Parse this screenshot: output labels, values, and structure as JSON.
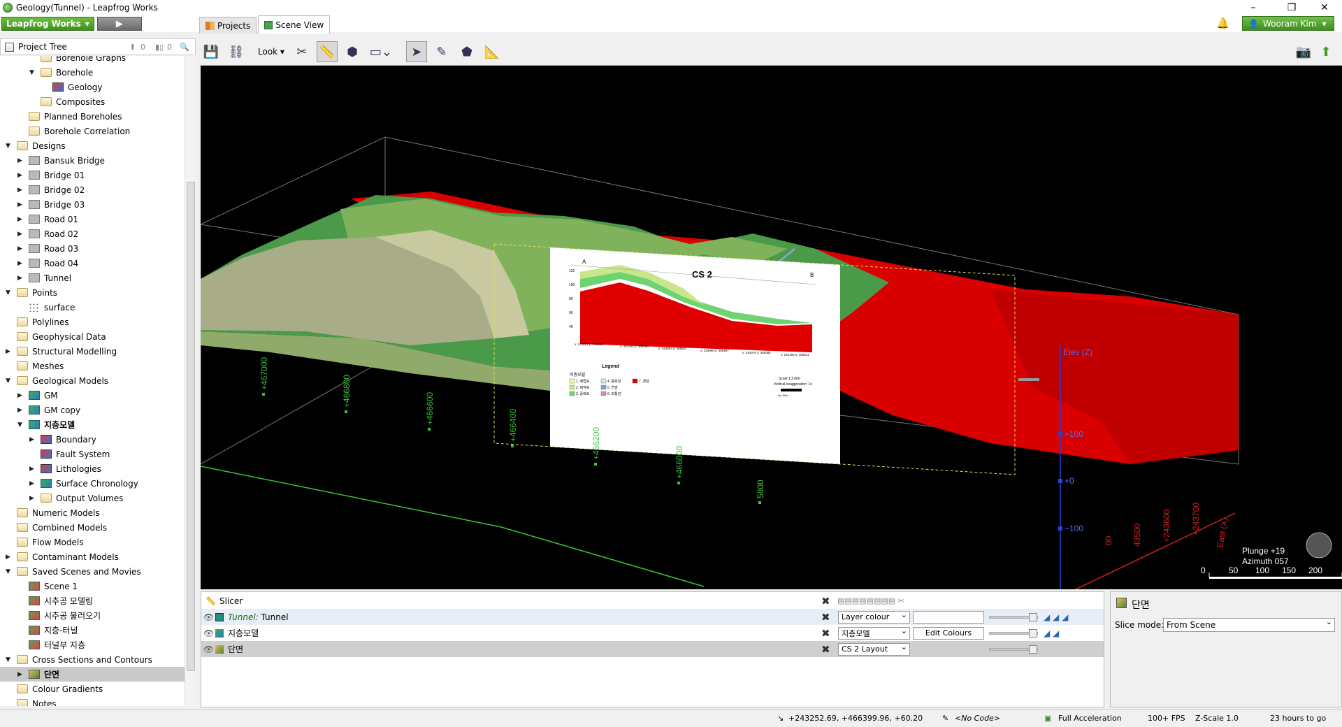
{
  "window": {
    "title": "Geology(Tunnel) - Leapfrog Works",
    "minimize": "–",
    "maximize": "❐",
    "close": "✕"
  },
  "toolbar": {
    "app_button": "Leapfrog Works",
    "app_caret": "▾",
    "play": "▶",
    "bell": "🔔",
    "user": "Wooram Kim",
    "user_caret": "▾"
  },
  "tabs": [
    {
      "label": "Projects"
    },
    {
      "label": "Scene View"
    }
  ],
  "project_tree": {
    "header": "Project Tree",
    "count_a": "0",
    "count_b": "0",
    "items": [
      {
        "label": "Borehole Graphs",
        "depth": 2,
        "icon": "folder",
        "expander": ""
      },
      {
        "label": "Borehole",
        "depth": 2,
        "icon": "folder",
        "expander": "▼"
      },
      {
        "label": "Geology",
        "depth": 3,
        "icon": "geo",
        "expander": ""
      },
      {
        "label": "Composites",
        "depth": 2,
        "icon": "folder",
        "expander": ""
      },
      {
        "label": "Planned Boreholes",
        "depth": 1,
        "icon": "folder",
        "expander": ""
      },
      {
        "label": "Borehole Correlation",
        "depth": 1,
        "icon": "folder",
        "expander": ""
      },
      {
        "label": "Designs",
        "depth": 0,
        "icon": "folder",
        "expander": "▼"
      },
      {
        "label": "Bansuk Bridge",
        "depth": 1,
        "icon": "bore",
        "expander": "▶"
      },
      {
        "label": "Bridge 01",
        "depth": 1,
        "icon": "bore",
        "expander": "▶"
      },
      {
        "label": "Bridge 02",
        "depth": 1,
        "icon": "bore",
        "expander": "▶"
      },
      {
        "label": "Bridge 03",
        "depth": 1,
        "icon": "bore",
        "expander": "▶"
      },
      {
        "label": "Road 01",
        "depth": 1,
        "icon": "bore",
        "expander": "▶"
      },
      {
        "label": "Road 02",
        "depth": 1,
        "icon": "bore",
        "expander": "▶"
      },
      {
        "label": "Road 03",
        "depth": 1,
        "icon": "bore",
        "expander": "▶"
      },
      {
        "label": "Road 04",
        "depth": 1,
        "icon": "bore",
        "expander": "▶"
      },
      {
        "label": "Tunnel",
        "depth": 1,
        "icon": "bore",
        "expander": "▶"
      },
      {
        "label": "Points",
        "depth": 0,
        "icon": "folder",
        "expander": "▼"
      },
      {
        "label": "surface",
        "depth": 1,
        "icon": "pts",
        "expander": ""
      },
      {
        "label": "Polylines",
        "depth": 0,
        "icon": "folder",
        "expander": ""
      },
      {
        "label": "Geophysical Data",
        "depth": 0,
        "icon": "folder",
        "expander": ""
      },
      {
        "label": "Structural Modelling",
        "depth": 0,
        "icon": "folder",
        "expander": "▶"
      },
      {
        "label": "Meshes",
        "depth": 0,
        "icon": "folder",
        "expander": ""
      },
      {
        "label": "Geological Models",
        "depth": 0,
        "icon": "folder",
        "expander": "▼"
      },
      {
        "label": "GM",
        "depth": 1,
        "icon": "gm",
        "expander": "▶"
      },
      {
        "label": "GM copy",
        "depth": 1,
        "icon": "gm",
        "expander": "▶"
      },
      {
        "label": "지층모델",
        "depth": 1,
        "icon": "gm",
        "expander": "▼",
        "bold": true
      },
      {
        "label": "Boundary",
        "depth": 2,
        "icon": "geo",
        "expander": "▶"
      },
      {
        "label": "Fault System",
        "depth": 2,
        "icon": "geo",
        "expander": ""
      },
      {
        "label": "Lithologies",
        "depth": 2,
        "icon": "geo",
        "expander": "▶"
      },
      {
        "label": "Surface Chronology",
        "depth": 2,
        "icon": "gm",
        "expander": "▶"
      },
      {
        "label": "Output Volumes",
        "depth": 2,
        "icon": "folder",
        "expander": "▶"
      },
      {
        "label": "Numeric Models",
        "depth": 0,
        "icon": "folder",
        "expander": ""
      },
      {
        "label": "Combined Models",
        "depth": 0,
        "icon": "folder",
        "expander": ""
      },
      {
        "label": "Flow Models",
        "depth": 0,
        "icon": "folder",
        "expander": ""
      },
      {
        "label": "Contaminant Models",
        "depth": 0,
        "icon": "folder",
        "expander": "▶"
      },
      {
        "label": "Saved Scenes and Movies",
        "depth": 0,
        "icon": "folder",
        "expander": "▼"
      },
      {
        "label": "Scene 1",
        "depth": 1,
        "icon": "scene",
        "expander": ""
      },
      {
        "label": "시추공 모델링",
        "depth": 1,
        "icon": "scene",
        "expander": ""
      },
      {
        "label": "시추공 불러오기",
        "depth": 1,
        "icon": "scene",
        "expander": ""
      },
      {
        "label": "지층-터널",
        "depth": 1,
        "icon": "scene",
        "expander": ""
      },
      {
        "label": "터널부 지층",
        "depth": 1,
        "icon": "scene",
        "expander": ""
      },
      {
        "label": "Cross Sections and Contours",
        "depth": 0,
        "icon": "folder",
        "expander": "▼"
      },
      {
        "label": "단면",
        "depth": 1,
        "icon": "xsec",
        "expander": "▶",
        "bold": true,
        "selected": true
      },
      {
        "label": "Colour Gradients",
        "depth": 0,
        "icon": "folder",
        "expander": ""
      },
      {
        "label": "Notes",
        "depth": 0,
        "icon": "folder",
        "expander": ""
      }
    ]
  },
  "view_toolbar": {
    "look": "Look ▾"
  },
  "scene": {
    "axis_labels": [
      "+467000",
      "+466800",
      "+466600",
      "+466400",
      "+466200",
      "+466000",
      "5800"
    ],
    "east_labels": [
      "+243700",
      "+243600",
      "43500",
      "00"
    ],
    "elev_title": "Elev (Z)",
    "elev_ticks": [
      "+100",
      "+0",
      "−100"
    ],
    "east_title": "East (X)",
    "plunge": "Plunge +19",
    "azimuth": "Azimuth 057",
    "scale_ticks": [
      "0",
      "50",
      "100",
      "150",
      "200"
    ],
    "section": {
      "title": "CS 2",
      "label_a": "A",
      "label_b": "B",
      "y_ticks": [
        "120",
        "100",
        "80",
        "60",
        "40"
      ],
      "x_ticks": [
        "x: 243601\ny: 466653",
        "x: 243754\ny: 466586",
        "x: 243853\ny: 466521",
        "x: 243966\ny: 466457",
        "x: 244076\ny: 466384",
        "x: 244193\ny: 466311"
      ],
      "legend_title": "Legend",
      "legend_sub": "지층모델",
      "legend_items": [
        {
          "label": "1. 매립토",
          "color": "#f5f5a0"
        },
        {
          "label": "2. 퇴적토",
          "color": "#c8e68a"
        },
        {
          "label": "3. 풍화토",
          "color": "#6fd36f"
        },
        {
          "label": "4. 풍화암",
          "color": "#c8e6f0"
        },
        {
          "label": "5. 연암",
          "color": "#7aa6d6"
        },
        {
          "label": "6. 보통암",
          "color": "#d98ab3"
        },
        {
          "label": "7. 경암",
          "color": "#e00000"
        }
      ],
      "scale": "Scale 1:2,000",
      "vexag": "Vertical exaggeration: 1x",
      "scale_bar": "0m        50m"
    }
  },
  "scene_list": {
    "rows": [
      {
        "name": "Slicer",
        "italic_prefix": ""
      },
      {
        "name": "Tunnel",
        "italic_prefix": "Tunnel:",
        "colour": "Layer colour"
      },
      {
        "name": "지층모델",
        "colour": "지층모델",
        "button": "Edit Colours"
      },
      {
        "name": "단면",
        "colour": "CS 2 Layout"
      }
    ]
  },
  "props": {
    "title": "단면",
    "slice_mode_label": "Slice mode:",
    "slice_mode": "From Scene"
  },
  "status": {
    "coords": "+243252.69, +466399.96, +60.20",
    "code": "<No Code>",
    "accel": "Full Acceleration",
    "fps": "100+ FPS",
    "zscale": "Z-Scale 1.0",
    "time": "23 hours to go"
  },
  "colors": {
    "accent": "#4a9a28",
    "viewport_border": "#e6a23c"
  }
}
